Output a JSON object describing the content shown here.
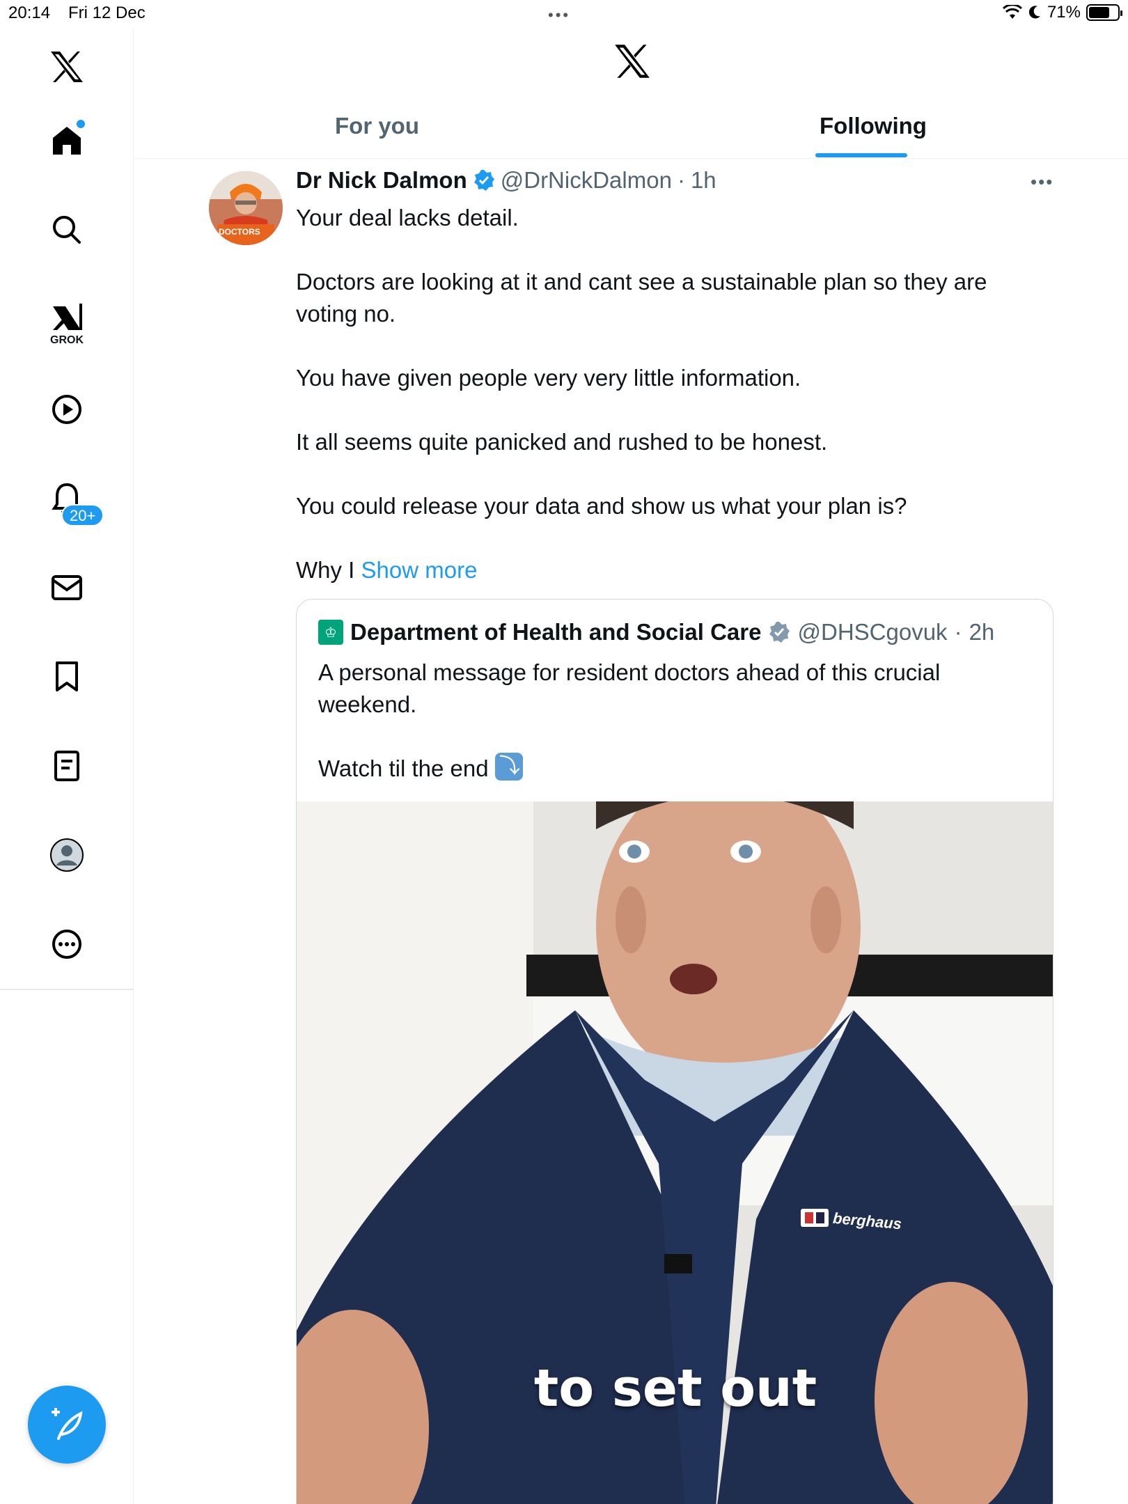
{
  "status_bar": {
    "time": "20:14",
    "date": "Fri 12 Dec",
    "battery": "71%",
    "battery_level": 0.71
  },
  "sidebar": {
    "items": [
      {
        "icon": "x-logo-icon"
      },
      {
        "icon": "home-icon",
        "has_dot": true
      },
      {
        "icon": "search-icon"
      },
      {
        "icon": "grok-icon",
        "label": "GROK"
      },
      {
        "icon": "video-play-icon"
      },
      {
        "icon": "notifications-bell-icon",
        "badge": "20+"
      },
      {
        "icon": "messages-mail-icon"
      },
      {
        "icon": "bookmark-icon"
      },
      {
        "icon": "lists-icon"
      },
      {
        "icon": "profile-icon"
      },
      {
        "icon": "more-circle-icon"
      }
    ],
    "compose_icon": "compose-post-icon"
  },
  "header": {
    "tabs": [
      {
        "label": "For you",
        "active": false
      },
      {
        "label": "Following",
        "active": true
      }
    ]
  },
  "tweet": {
    "name": "Dr Nick Dalmon",
    "verified": true,
    "handle": "@DrNickDalmon",
    "time": "1h",
    "paragraphs": [
      "Your deal lacks detail.",
      "Doctors are looking at it and cant see a sustainable plan so they are voting no.",
      "You have given people very very little information.",
      "It all seems quite panicked and rushed to be honest.",
      "You could release your data and show us what your plan is?"
    ],
    "truncated_text": "Why I",
    "show_more": "Show more",
    "avatar_badge_text": "DOCTORS",
    "quote": {
      "name": "Department of Health and Social Care",
      "handle": "@DHSCgovuk",
      "time": "2h",
      "paragraphs": [
        "A personal message for resident doctors ahead of this crucial weekend.",
        "Watch til the end"
      ],
      "video_caption": "to set out",
      "jacket_brand": "berghaus"
    }
  },
  "colors": {
    "accent": "#1d9bf0",
    "text_primary": "#0f1419",
    "text_secondary": "#536471",
    "gov_green": "#00a47a"
  }
}
